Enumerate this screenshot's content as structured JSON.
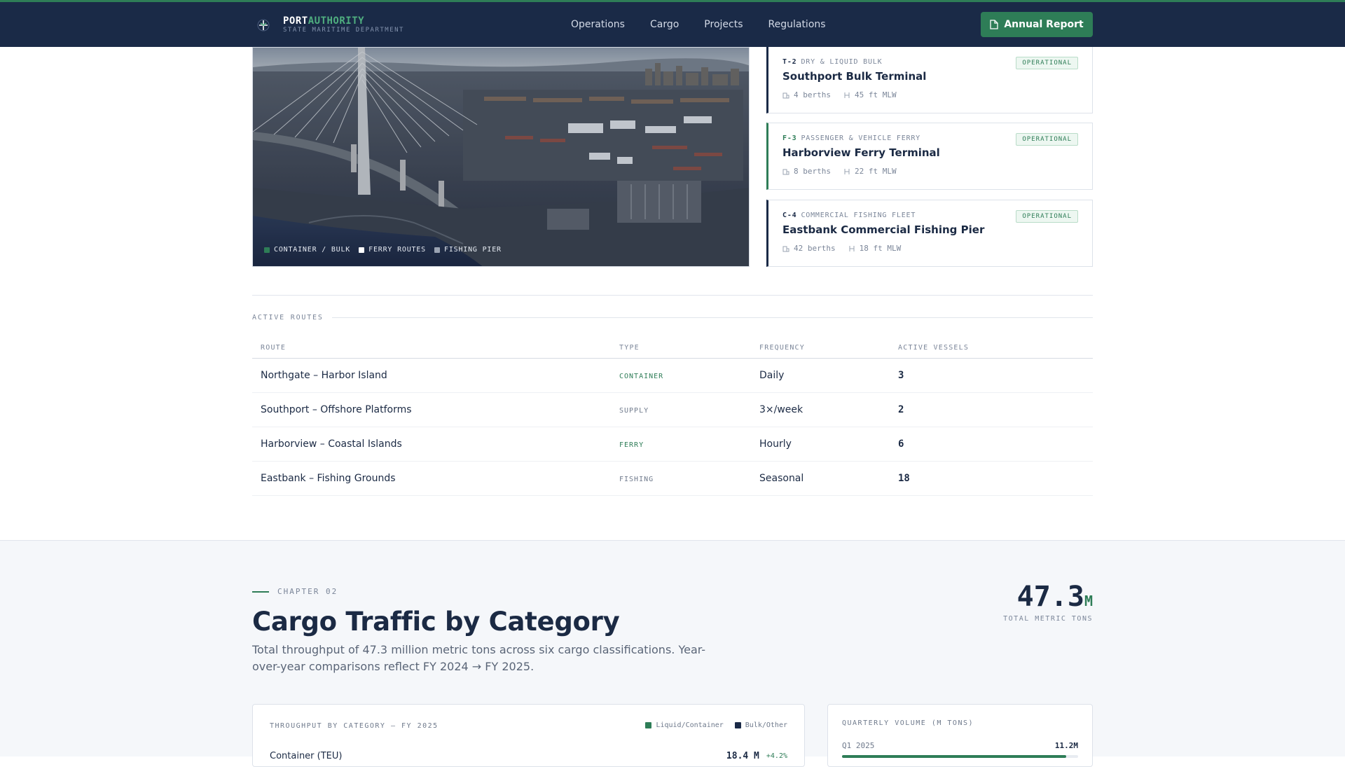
{
  "brand": {
    "name_part1": "PORT",
    "name_part2": "AUTHORITY",
    "subtitle": "STATE MARITIME DEPARTMENT"
  },
  "nav": {
    "links": [
      "Operations",
      "Cargo",
      "Projects",
      "Regulations"
    ],
    "cta": "Annual Report"
  },
  "hero": {
    "legend": [
      {
        "label": "CONTAINER / BULK",
        "color": "#2e7d57"
      },
      {
        "label": "FERRY ROUTES",
        "color": "#ffffff"
      },
      {
        "label": "FISHING PIER",
        "color": "#9aa3b2"
      }
    ]
  },
  "terminals": [
    {
      "code": "T-2",
      "category": "DRY & LIQUID BULK",
      "name": "Southport Bulk Terminal",
      "berths": "4 berths",
      "depth": "45 ft MLW",
      "status": "OPERATIONAL",
      "accent": "#1a2a47"
    },
    {
      "code": "F-3",
      "category": "PASSENGER & VEHICLE FERRY",
      "name": "Harborview Ferry Terminal",
      "berths": "8 berths",
      "depth": "22 ft MLW",
      "status": "OPERATIONAL",
      "accent": "#2e7d57"
    },
    {
      "code": "C-4",
      "category": "COMMERCIAL FISHING FLEET",
      "name": "Eastbank Commercial Fishing Pier",
      "berths": "42 berths",
      "depth": "18 ft MLW",
      "status": "OPERATIONAL",
      "accent": "#1a2a47"
    }
  ],
  "routes": {
    "heading": "ACTIVE ROUTES",
    "columns": [
      "ROUTE",
      "TYPE",
      "FREQUENCY",
      "ACTIVE VESSELS"
    ],
    "rows": [
      {
        "route": "Northgate – Harbor Island",
        "type": "CONTAINER",
        "frequency": "Daily",
        "vessels": "3"
      },
      {
        "route": "Southport – Offshore Platforms",
        "type": "SUPPLY",
        "frequency": "3×/week",
        "vessels": "2"
      },
      {
        "route": "Harborview – Coastal Islands",
        "type": "FERRY",
        "frequency": "Hourly",
        "vessels": "6"
      },
      {
        "route": "Eastbank – Fishing Grounds",
        "type": "FISHING",
        "frequency": "Seasonal",
        "vessels": "18"
      }
    ]
  },
  "chapter": {
    "kicker": "CHAPTER 02",
    "title": "Cargo Traffic by Category",
    "description": "Total throughput of 47.3 million metric tons across six cargo classifications. Year-over-year comparisons reflect FY 2024 → FY 2025.",
    "stat_value": "47.3",
    "stat_unit": "M",
    "stat_label": "TOTAL METRIC TONS"
  },
  "throughput_panel": {
    "title": "THROUGHPUT BY CATEGORY — FY 2025",
    "legend": [
      {
        "label": "Liquid/Container",
        "color": "#2e7d57"
      },
      {
        "label": "Bulk/Other",
        "color": "#1a2a47"
      }
    ],
    "first_row": {
      "label": "Container (TEU)",
      "value": "18.4 M",
      "change": "+4.2%"
    }
  },
  "quarterly_panel": {
    "title": "QUARTERLY VOLUME (M TONS)",
    "first_row": {
      "quarter": "Q1 2025",
      "value": "11.2M",
      "fraction": 0.95
    }
  }
}
